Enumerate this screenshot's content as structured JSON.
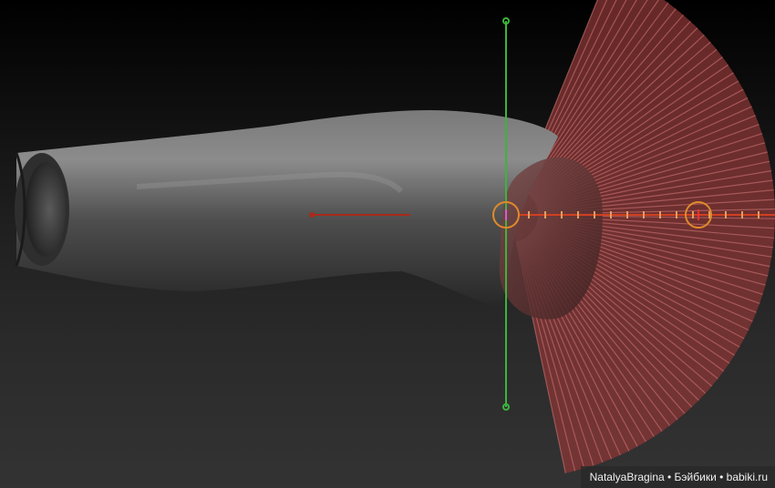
{
  "viewport": {
    "background_top": "#000000",
    "background_bottom": "#333333"
  },
  "model": {
    "body_color": "#5a5a5a",
    "fan_color": "#8a3535",
    "fan_stroke": "#c06a6a"
  },
  "gizmo": {
    "axis_x_color": "#d04020",
    "axis_y_color": "#3cb43c",
    "handle_color": "#e08a2a",
    "tick_color": "#e0a060"
  },
  "watermark": {
    "text": "NatalyaBragina • Бэйбики • babiki.ru"
  }
}
